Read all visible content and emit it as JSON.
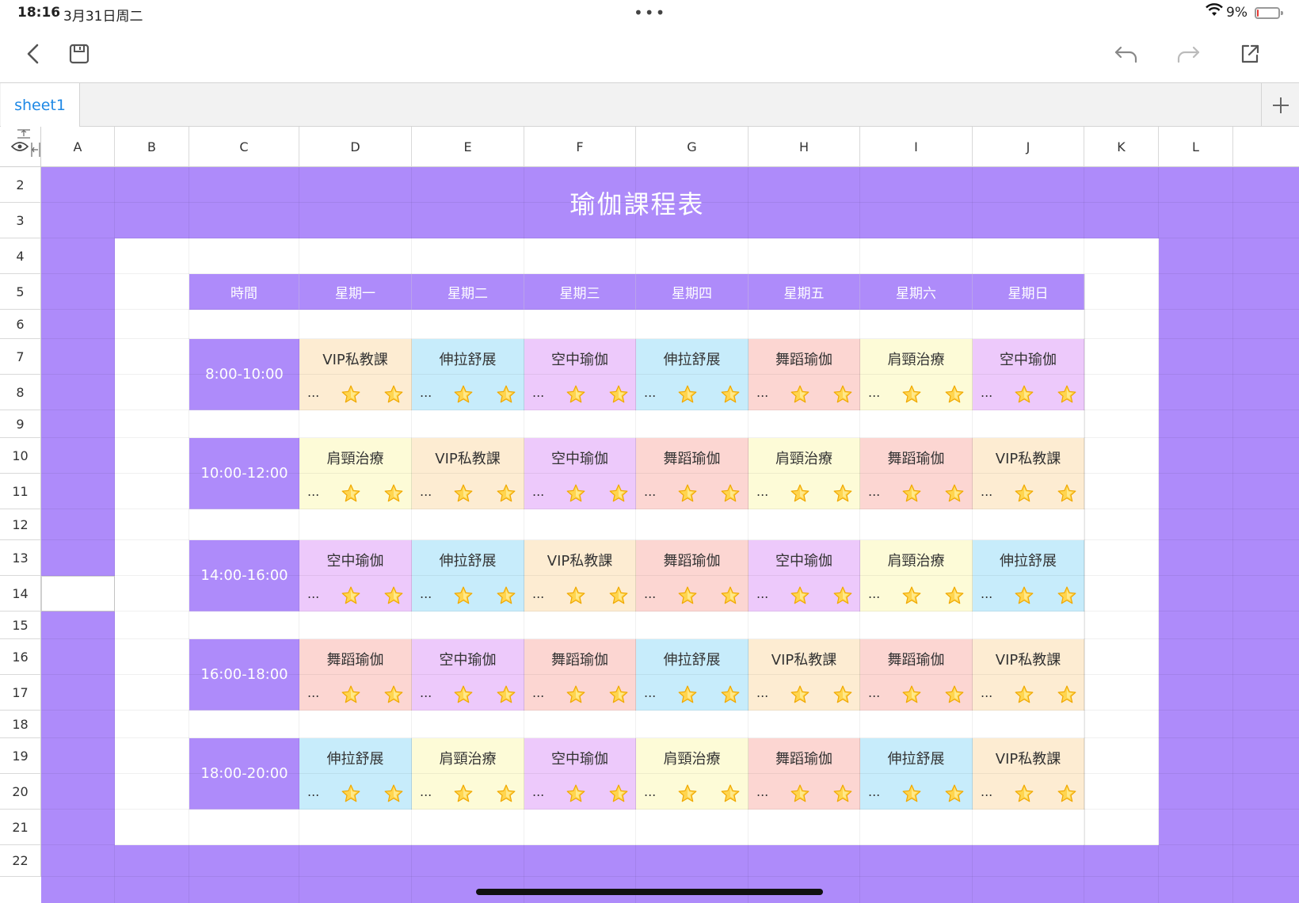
{
  "status": {
    "time": "18:16",
    "date": "3月31日周二",
    "battery": "9%",
    "battery_level": 0.09
  },
  "toolbar": {
    "back_icon": "chevron-left-icon",
    "save_icon": "save-icon",
    "undo_icon": "undo-icon",
    "redo_icon": "redo-icon",
    "share_icon": "share-icon"
  },
  "tabs": {
    "sheet_name": "sheet1",
    "add_icon": "plus-icon"
  },
  "columns": [
    "A",
    "B",
    "C",
    "D",
    "E",
    "F",
    "G",
    "H",
    "I",
    "J",
    "K",
    "L"
  ],
  "rows": [
    "2",
    "3",
    "4",
    "5",
    "6",
    "7",
    "8",
    "9",
    "10",
    "11",
    "12",
    "13",
    "14",
    "15",
    "16",
    "17",
    "18",
    "19",
    "20",
    "21",
    "22"
  ],
  "schedule": {
    "title": "瑜伽課程表",
    "headers": [
      "時間",
      "星期一",
      "星期二",
      "星期三",
      "星期四",
      "星期五",
      "星期六",
      "星期日"
    ],
    "more_text": "...",
    "stars_per_cell": 2,
    "slots": [
      {
        "time": "8:00-10:00",
        "courses": [
          "VIP私教課",
          "伸拉舒展",
          "空中瑜伽",
          "伸拉舒展",
          "舞蹈瑜伽",
          "肩頸治療",
          "空中瑜伽"
        ]
      },
      {
        "time": "10:00-12:00",
        "courses": [
          "肩頸治療",
          "VIP私教課",
          "空中瑜伽",
          "舞蹈瑜伽",
          "肩頸治療",
          "舞蹈瑜伽",
          "VIP私教課"
        ]
      },
      {
        "time": "14:00-16:00",
        "courses": [
          "空中瑜伽",
          "伸拉舒展",
          "VIP私教課",
          "舞蹈瑜伽",
          "空中瑜伽",
          "肩頸治療",
          "伸拉舒展"
        ]
      },
      {
        "time": "16:00-18:00",
        "courses": [
          "舞蹈瑜伽",
          "空中瑜伽",
          "舞蹈瑜伽",
          "伸拉舒展",
          "VIP私教課",
          "舞蹈瑜伽",
          "VIP私教課"
        ]
      },
      {
        "time": "18:00-20:00",
        "courses": [
          "伸拉舒展",
          "肩頸治療",
          "空中瑜伽",
          "肩頸治療",
          "舞蹈瑜伽",
          "伸拉舒展",
          "VIP私教課"
        ]
      }
    ],
    "course_colors": {
      "VIP私教課": "#fdecd2",
      "伸拉舒展": "#c7ecfb",
      "空中瑜伽": "#edc9fb",
      "舞蹈瑜伽": "#fcd6d2",
      "肩頸治療": "#fdfbd7"
    },
    "accent": "#ae8bfa"
  }
}
